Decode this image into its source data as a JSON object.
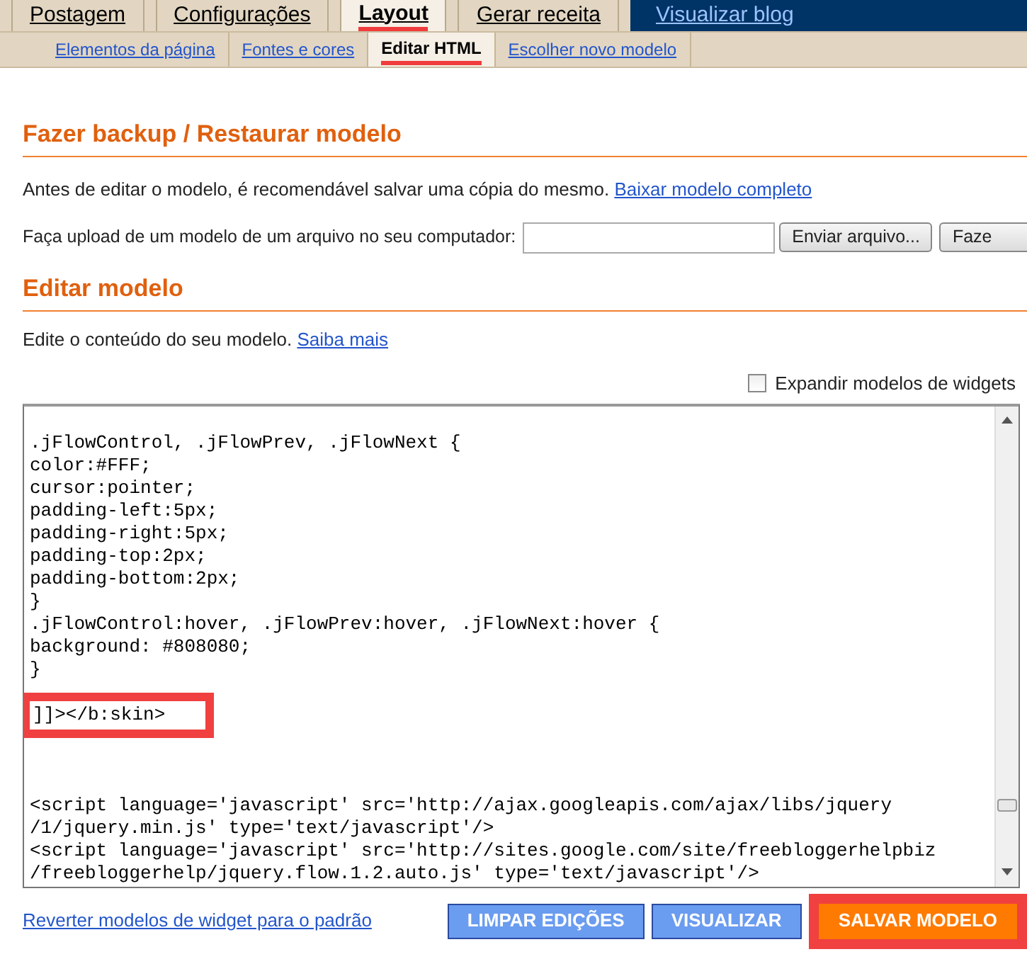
{
  "tabs": [
    {
      "label": "Postagem",
      "selected": false
    },
    {
      "label": "Configurações",
      "selected": false
    },
    {
      "label": "Layout",
      "selected": true
    },
    {
      "label": "Gerar receita",
      "selected": false
    }
  ],
  "view_blog_link": "Visualizar blog",
  "subtabs": [
    {
      "label": "Elementos da página",
      "selected": false
    },
    {
      "label": "Fontes e cores",
      "selected": false
    },
    {
      "label": "Editar HTML",
      "selected": true
    },
    {
      "label": "Escolher novo modelo",
      "selected": false
    }
  ],
  "backup": {
    "title": "Fazer backup / Restaurar modelo",
    "text": "Antes de editar o modelo, é recomendável salvar uma cópia do mesmo.",
    "download_link": "Baixar modelo completo",
    "upload_label": "Faça upload de um modelo de um arquivo no seu computador:",
    "browse_button": "Enviar arquivo...",
    "upload_button": "Faze"
  },
  "edit": {
    "title": "Editar modelo",
    "text": "Edite o conteúdo do seu modelo.",
    "learn_more_link": "Saiba mais",
    "expand_widgets": {
      "label": "Expandir modelos de widgets",
      "checked": false
    }
  },
  "code": [
    {
      "highlighted": false,
      "lines": [
        ".jFlowControl, .jFlowPrev, .jFlowNext {",
        "color:#FFF;",
        "cursor:pointer;",
        "padding-left:5px;",
        "padding-right:5px;",
        "padding-top:2px;",
        "padding-bottom:2px;",
        "}",
        ".jFlowControl:hover, .jFlowPrev:hover, .jFlowNext:hover {",
        "background: #808080;",
        "}"
      ]
    },
    {
      "highlighted": true,
      "lines": [
        "]]></b:skin>"
      ]
    },
    {
      "highlighted": false,
      "lines": [
        "<script language='javascript' src='http://ajax.googleapis.com/ajax/libs/jquery",
        "/1/jquery.min.js' type='text/javascript'/>",
        "<script language='javascript' src='http://sites.google.com/site/freebloggerhelpbiz",
        "/freebloggerhelp/jquery.flow.1.2.auto.js' type='text/javascript'/>"
      ]
    }
  ],
  "revert_link": "Reverter modelos de widget para o padrão",
  "buttons": [
    {
      "label": "LIMPAR EDIÇÕES",
      "kind": "secondary",
      "highlighted": false
    },
    {
      "label": "VISUALIZAR",
      "kind": "secondary",
      "highlighted": false
    },
    {
      "label": "SALVAR MODELO",
      "kind": "primary",
      "highlighted": true
    }
  ]
}
